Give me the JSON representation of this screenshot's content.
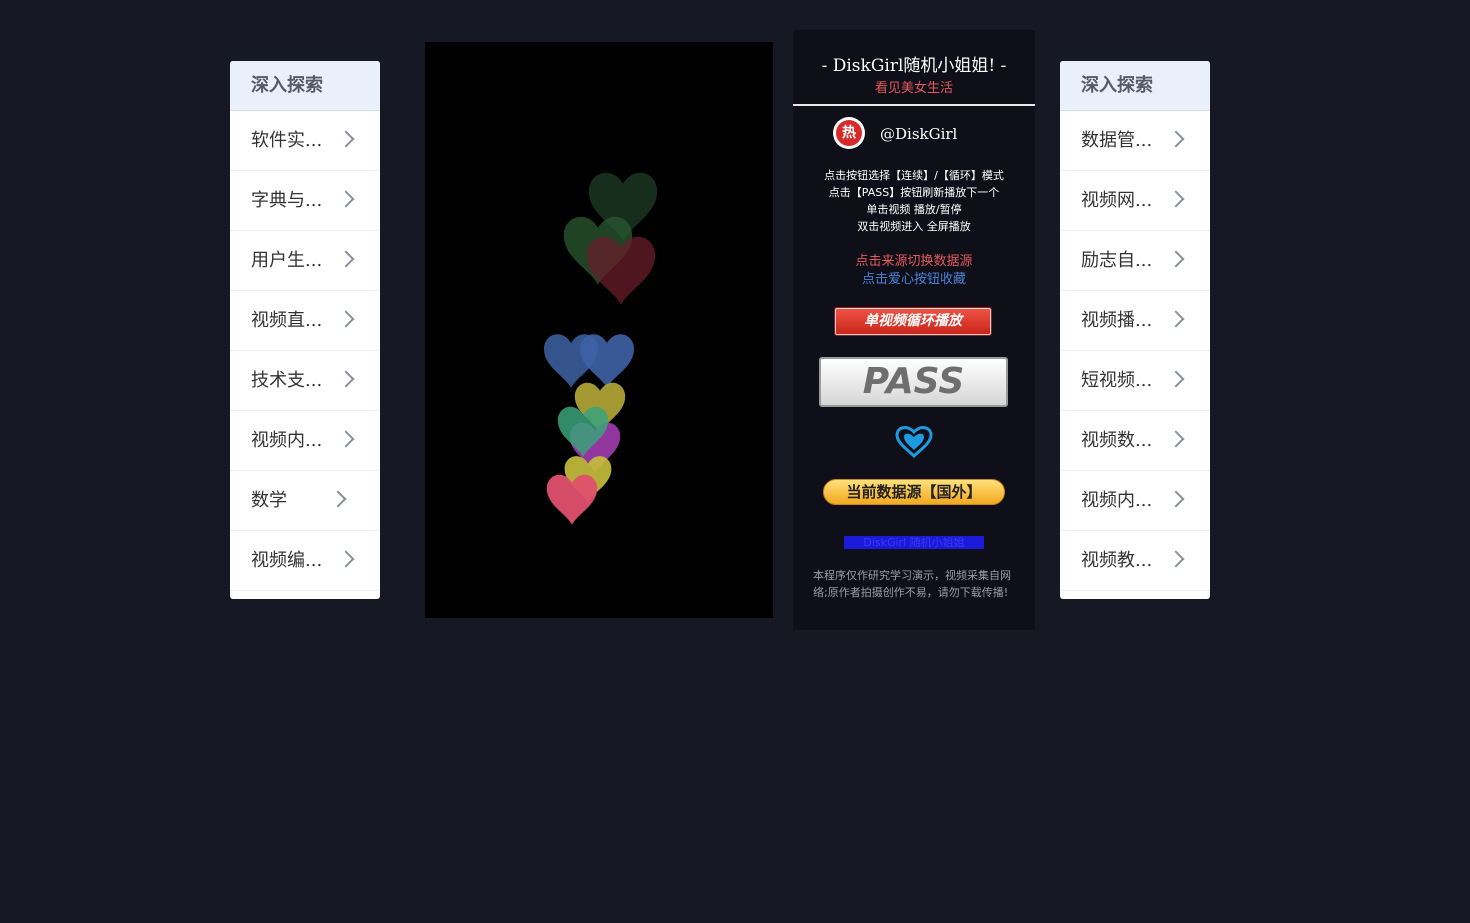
{
  "left_panel": {
    "header": "深入探索",
    "items": [
      {
        "label": "软件实..."
      },
      {
        "label": "字典与..."
      },
      {
        "label": "用户生..."
      },
      {
        "label": "视频直..."
      },
      {
        "label": "技术支..."
      },
      {
        "label": "视频内..."
      },
      {
        "label": "数学"
      },
      {
        "label": "视频编..."
      }
    ]
  },
  "right_panel": {
    "header": "深入探索",
    "items": [
      {
        "label": "数据管..."
      },
      {
        "label": "视频网..."
      },
      {
        "label": "励志自..."
      },
      {
        "label": "视频播..."
      },
      {
        "label": "短视频..."
      },
      {
        "label": "视频数..."
      },
      {
        "label": "视频内..."
      },
      {
        "label": "视频教..."
      }
    ]
  },
  "info": {
    "title": "- DiskGirl随机小姐姐! -",
    "subtitle": "看见美女生活",
    "avatar_char": "热",
    "handle": "@DiskGirl",
    "instructions": [
      "点击按钮选择【连续】/【循环】模式",
      "点击【PASS】按钮刷新播放下一个",
      "单击视频 播放/暂停",
      "双击视频进入 全屏播放"
    ],
    "hint_source": "点击来源切换数据源",
    "hint_favorite": "点击爱心按钮收藏",
    "loop_button": "单视频循环播放",
    "pass_button": "PASS",
    "source_button": "当前数据源【国外】",
    "link_text": "DiskGirl 随机小姐姐",
    "disclaimer": "本程序仅作研究学习演示，视频采集自网络;原作者拍摄创作不易，请勿下载传播!"
  },
  "icons": {
    "favorite": "heart-icon",
    "chevron": "chevron-right-icon",
    "video_hearts": "floating-hearts-icon"
  },
  "colors": {
    "background": "#161824",
    "accent_red": "#e35a5a",
    "accent_blue": "#4a82d4",
    "panel": "#0e0f19"
  }
}
